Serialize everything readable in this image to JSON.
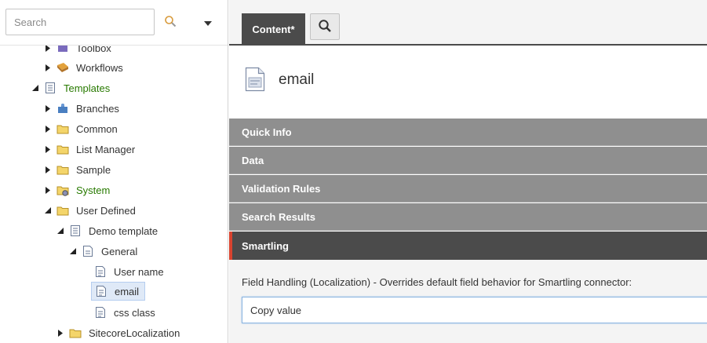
{
  "search": {
    "placeholder": "Search"
  },
  "tree": {
    "toolbox": "Toolbox",
    "workflows": "Workflows",
    "templates": "Templates",
    "branches": "Branches",
    "common": "Common",
    "list_manager": "List Manager",
    "sample": "Sample",
    "system": "System",
    "user_defined": "User Defined",
    "demo_template": "Demo template",
    "general": "General",
    "user_name": "User name",
    "email": "email",
    "css_class": "css class",
    "sitecore_localization": "SitecoreLocalization"
  },
  "tabs": {
    "content": "Content*"
  },
  "item": {
    "title": "email"
  },
  "sections": {
    "quick_info": "Quick Info",
    "data": "Data",
    "validation_rules": "Validation Rules",
    "search_results": "Search Results",
    "smartling": "Smartling"
  },
  "field": {
    "label": "Field Handling (Localization) - Overrides default field behavior for Smartling connector:",
    "value": "Copy value"
  },
  "colors": {
    "active_section_accent": "#d9432f",
    "section_bg": "#8f8f8f",
    "active_section_bg": "#4b4b4b",
    "green_label": "#287a00"
  }
}
